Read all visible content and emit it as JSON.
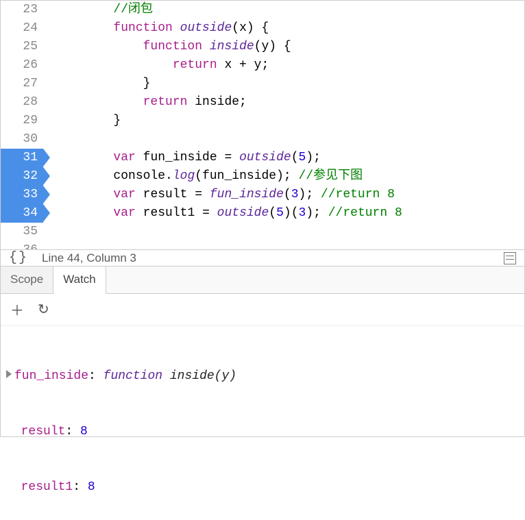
{
  "gutter": {
    "23": "23",
    "24": "24",
    "25": "25",
    "26": "26",
    "27": "27",
    "28": "28",
    "29": "29",
    "30": "30",
    "31": "31",
    "32": "32",
    "33": "33",
    "34": "34",
    "35": "35",
    "36": "36"
  },
  "code": {
    "l23": {
      "cmt": "//闭包"
    },
    "l24": {
      "kw": "function",
      "name": "outside",
      "param": "x"
    },
    "l25": {
      "kw": "function",
      "name": "inside",
      "param": "y"
    },
    "l26": {
      "kw": "return",
      "expr": "x + y;"
    },
    "l27": {
      "brace": "}"
    },
    "l28": {
      "kw": "return",
      "expr": "inside;"
    },
    "l29": {
      "brace": "}"
    },
    "l31": {
      "kw": "var",
      "name": "fun_inside",
      "call": "outside",
      "arg": "5"
    },
    "l32": {
      "obj": "console",
      "method": "log",
      "arg": "fun_inside",
      "cmt": "//参见下图"
    },
    "l33": {
      "kw": "var",
      "name": "result",
      "call": "fun_inside",
      "arg": "3",
      "cmt": "//return 8"
    },
    "l34": {
      "kw": "var",
      "name": "result1",
      "call": "outside",
      "arg1": "5",
      "arg2": "3",
      "cmt": "//return 8"
    }
  },
  "status": {
    "text": "Line 44, Column 3",
    "format_icon": "{}"
  },
  "tabs": {
    "scope": "Scope",
    "watch": "Watch"
  },
  "toolbar": {
    "add": "＋",
    "refresh": "↻"
  },
  "watch": {
    "item1": {
      "name": "fun_inside",
      "fnword": "function",
      "fnsig": "inside(y)"
    },
    "item2": {
      "name": "result",
      "val": "8"
    },
    "item3": {
      "name": "result1",
      "val": "8"
    }
  }
}
